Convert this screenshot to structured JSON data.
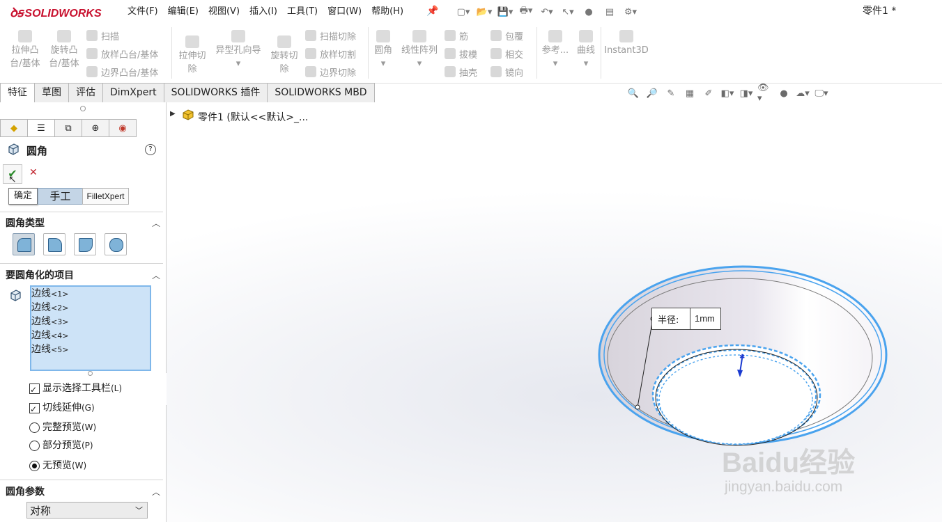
{
  "app": {
    "logo": "SOLIDWORKS",
    "document_title": "零件1 *"
  },
  "menus": [
    "文件(F)",
    "编辑(E)",
    "视图(V)",
    "插入(I)",
    "工具(T)",
    "窗口(W)",
    "帮助(H)"
  ],
  "ribbon": {
    "extrude_boss": [
      "拉伸凸",
      "台/基体"
    ],
    "revolve_boss": [
      "旋转凸",
      "台/基体"
    ],
    "sweep": "扫描",
    "loft_boss": "放样凸台/基体",
    "boundary_boss": "边界凸台/基体",
    "extrude_cut": [
      "拉伸切",
      "除"
    ],
    "hole_wizard": "异型孔向导",
    "revolve_cut": [
      "旋转切",
      "除"
    ],
    "sweep_cut": "扫描切除",
    "loft_cut": "放样切割",
    "boundary_cut": "边界切除",
    "fillet": "圆角",
    "linear_pattern": "线性阵列",
    "rib": "筋",
    "draft": "拔模",
    "shell": "抽壳",
    "wrap": "包覆",
    "intersect": "相交",
    "mirror": "镜向",
    "reference": "参考...",
    "curves": "曲线",
    "instant3d": "Instant3D"
  },
  "tabs": [
    "特征",
    "草图",
    "评估",
    "DimXpert",
    "SOLIDWORKS 插件",
    "SOLIDWORKS MBD"
  ],
  "tree": {
    "root": "零件1  (默认<<默认>_..."
  },
  "property_manager": {
    "title": "圆角",
    "ok_tooltip": "确定",
    "mode_tabs": [
      "手工",
      "FilletXpert"
    ],
    "section_type": "圆角类型",
    "section_items": "要圆角化的项目",
    "edges": [
      {
        "label": "边线",
        "index": "<1>"
      },
      {
        "label": "边线",
        "index": "<2>"
      },
      {
        "label": "边线",
        "index": "<3>"
      },
      {
        "label": "边线",
        "index": "<4>"
      },
      {
        "label": "边线",
        "index": "<5>"
      }
    ],
    "options": {
      "show_toolbar": {
        "label": "显示选择工具栏",
        "key": "(L)",
        "checked": true
      },
      "tangent": {
        "label": "切线延伸",
        "key": "(G)",
        "checked": true
      },
      "full_preview": {
        "label": "完整预览",
        "key": "(W)",
        "selected": false
      },
      "partial_preview": {
        "label": "部分预览",
        "key": "(P)",
        "selected": false
      },
      "no_preview": {
        "label": "无预览",
        "key": "(W)",
        "selected": true
      }
    },
    "section_params": "圆角参数",
    "symmetry": "对称"
  },
  "callout": {
    "label": "半径:",
    "value": "1mm"
  },
  "watermark": {
    "main": "Baidu经验",
    "sub": "jingyan.baidu.com"
  },
  "colors": {
    "selection": "#4aa3ee",
    "logo_red": "#c8102e"
  }
}
